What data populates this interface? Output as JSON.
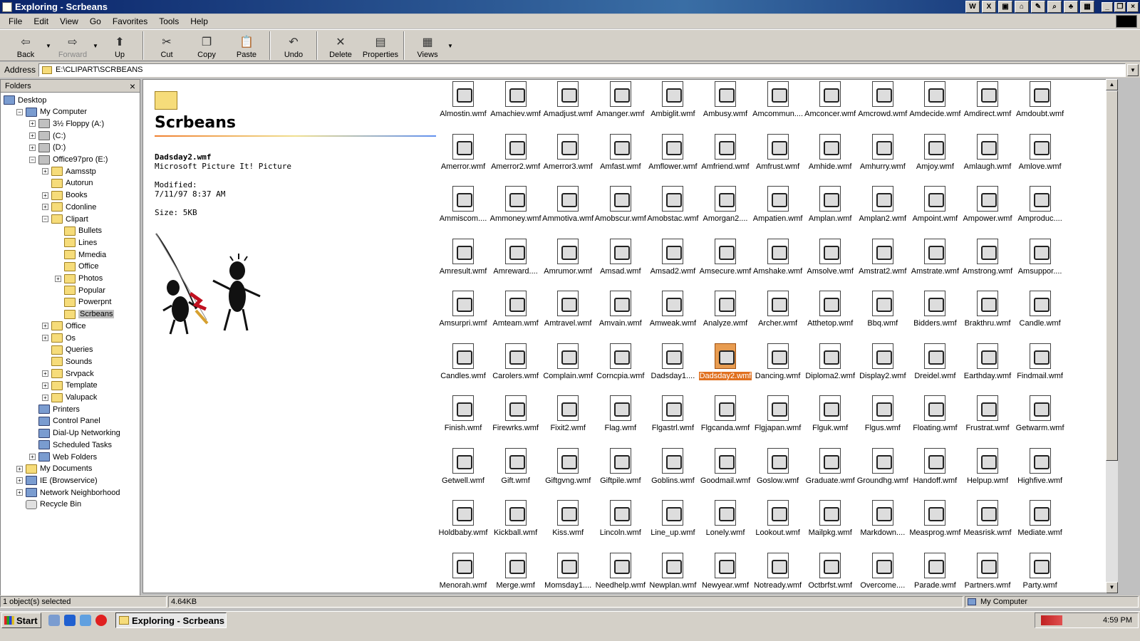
{
  "window": {
    "title": "Exploring - Scrbeans"
  },
  "quick_launch": [
    "W",
    "X",
    "▣",
    "⌂",
    "✎",
    "⌕",
    "♣",
    "▦"
  ],
  "menu": [
    "File",
    "Edit",
    "View",
    "Go",
    "Favorites",
    "Tools",
    "Help"
  ],
  "toolbar": [
    {
      "label": "Back",
      "icon": "⇦"
    },
    {
      "label": "Forward",
      "icon": "⇨",
      "disabled": true
    },
    {
      "label": "Up",
      "icon": "⬆"
    },
    {
      "label": "Cut",
      "icon": "✂"
    },
    {
      "label": "Copy",
      "icon": "❐"
    },
    {
      "label": "Paste",
      "icon": "📋"
    },
    {
      "label": "Undo",
      "icon": "↶"
    },
    {
      "label": "Delete",
      "icon": "✕"
    },
    {
      "label": "Properties",
      "icon": "▤"
    },
    {
      "label": "Views",
      "icon": "▦"
    }
  ],
  "address": {
    "label": "Address",
    "value": "E:\\CLIPART\\SCRBEANS"
  },
  "folders_pane": {
    "title": "Folders",
    "close": "×"
  },
  "tree": [
    {
      "label": "Desktop",
      "level": 0,
      "pm": "",
      "icon": "sys"
    },
    {
      "label": "My Computer",
      "level": 1,
      "pm": "-",
      "icon": "sys"
    },
    {
      "label": "3½ Floppy (A:)",
      "level": 2,
      "pm": "+",
      "icon": "drive"
    },
    {
      "label": "(C:)",
      "level": 2,
      "pm": "+",
      "icon": "drive"
    },
    {
      "label": "(D:)",
      "level": 2,
      "pm": "+",
      "icon": "drive"
    },
    {
      "label": "Office97pro (E:)",
      "level": 2,
      "pm": "-",
      "icon": "drive"
    },
    {
      "label": "Aamsstp",
      "level": 3,
      "pm": "+",
      "icon": "folder"
    },
    {
      "label": "Autorun",
      "level": 3,
      "pm": "",
      "icon": "folder"
    },
    {
      "label": "Books",
      "level": 3,
      "pm": "+",
      "icon": "folder"
    },
    {
      "label": "Cdonline",
      "level": 3,
      "pm": "+",
      "icon": "folder"
    },
    {
      "label": "Clipart",
      "level": 3,
      "pm": "-",
      "icon": "folder"
    },
    {
      "label": "Bullets",
      "level": 4,
      "pm": "",
      "icon": "folder"
    },
    {
      "label": "Lines",
      "level": 4,
      "pm": "",
      "icon": "folder"
    },
    {
      "label": "Mmedia",
      "level": 4,
      "pm": "",
      "icon": "folder"
    },
    {
      "label": "Office",
      "level": 4,
      "pm": "",
      "icon": "folder"
    },
    {
      "label": "Photos",
      "level": 4,
      "pm": "+",
      "icon": "folder"
    },
    {
      "label": "Popular",
      "level": 4,
      "pm": "",
      "icon": "folder"
    },
    {
      "label": "Powerpnt",
      "level": 4,
      "pm": "",
      "icon": "folder"
    },
    {
      "label": "Scrbeans",
      "level": 4,
      "pm": "",
      "icon": "folder",
      "selected": true
    },
    {
      "label": "Office",
      "level": 3,
      "pm": "+",
      "icon": "folder"
    },
    {
      "label": "Os",
      "level": 3,
      "pm": "+",
      "icon": "folder"
    },
    {
      "label": "Queries",
      "level": 3,
      "pm": "",
      "icon": "folder"
    },
    {
      "label": "Sounds",
      "level": 3,
      "pm": "",
      "icon": "folder"
    },
    {
      "label": "Srvpack",
      "level": 3,
      "pm": "+",
      "icon": "folder"
    },
    {
      "label": "Template",
      "level": 3,
      "pm": "+",
      "icon": "folder"
    },
    {
      "label": "Valupack",
      "level": 3,
      "pm": "+",
      "icon": "folder"
    },
    {
      "label": "Printers",
      "level": 2,
      "pm": "",
      "icon": "sys"
    },
    {
      "label": "Control Panel",
      "level": 2,
      "pm": "",
      "icon": "sys"
    },
    {
      "label": "Dial-Up Networking",
      "level": 2,
      "pm": "",
      "icon": "sys"
    },
    {
      "label": "Scheduled Tasks",
      "level": 2,
      "pm": "",
      "icon": "sys"
    },
    {
      "label": "Web Folders",
      "level": 2,
      "pm": "+",
      "icon": "sys"
    },
    {
      "label": "My Documents",
      "level": 1,
      "pm": "+",
      "icon": "folder"
    },
    {
      "label": "IE (Browservice)",
      "level": 1,
      "pm": "+",
      "icon": "sys"
    },
    {
      "label": "Network Neighborhood",
      "level": 1,
      "pm": "+",
      "icon": "sys"
    },
    {
      "label": "Recycle Bin",
      "level": 1,
      "pm": "",
      "icon": "bin"
    }
  ],
  "webview": {
    "folder_name": "Scrbeans",
    "file_name": "Dadsday2.wmf",
    "file_type": "Microsoft Picture It! Picture",
    "modified_label": "Modified:",
    "modified": "7/11/97 8:37 AM",
    "size": "Size: 5KB"
  },
  "files": [
    "Almostin.wmf",
    "Amachiev.wmf",
    "Amadjust.wmf",
    "Amanger.wmf",
    "Ambiglit.wmf",
    "Ambusy.wmf",
    "Amcommun....",
    "Amconcer.wmf",
    "Amcrowd.wmf",
    "Amdecide.wmf",
    "Amdirect.wmf",
    "Amdoubt.wmf",
    "Amerror.wmf",
    "Amerror2.wmf",
    "Amerror3.wmf",
    "Amfast.wmf",
    "Amflower.wmf",
    "Amfriend.wmf",
    "Amfrust.wmf",
    "Amhide.wmf",
    "Amhurry.wmf",
    "Amjoy.wmf",
    "Amlaugh.wmf",
    "Amlove.wmf",
    "Ammiscom....",
    "Ammoney.wmf",
    "Ammotiva.wmf",
    "Amobscur.wmf",
    "Amobstac.wmf",
    "Amorgan2....",
    "Ampatien.wmf",
    "Amplan.wmf",
    "Amplan2.wmf",
    "Ampoint.wmf",
    "Ampower.wmf",
    "Amproduc....",
    "Amresult.wmf",
    "Amreward....",
    "Amrumor.wmf",
    "Amsad.wmf",
    "Amsad2.wmf",
    "Amsecure.wmf",
    "Amshake.wmf",
    "Amsolve.wmf",
    "Amstrat2.wmf",
    "Amstrate.wmf",
    "Amstrong.wmf",
    "Amsuppor....",
    "Amsurpri.wmf",
    "Amteam.wmf",
    "Amtravel.wmf",
    "Amvain.wmf",
    "Amweak.wmf",
    "Analyze.wmf",
    "Archer.wmf",
    "Atthetop.wmf",
    "Bbq.wmf",
    "Bidders.wmf",
    "Brakthru.wmf",
    "Candle.wmf",
    "Candles.wmf",
    "Carolers.wmf",
    "Complain.wmf",
    "Corncpia.wmf",
    "Dadsday1....",
    "Dadsday2.wmf",
    "Dancing.wmf",
    "Diploma2.wmf",
    "Display2.wmf",
    "Dreidel.wmf",
    "Earthday.wmf",
    "Findmail.wmf",
    "Finish.wmf",
    "Firewrks.wmf",
    "Fixit2.wmf",
    "Flag.wmf",
    "Flgastrl.wmf",
    "Flgcanda.wmf",
    "Flgjapan.wmf",
    "Flguk.wmf",
    "Flgus.wmf",
    "Floating.wmf",
    "Frustrat.wmf",
    "Getwarm.wmf",
    "Getwell.wmf",
    "Gift.wmf",
    "Giftgvng.wmf",
    "Giftpile.wmf",
    "Goblins.wmf",
    "Goodmail.wmf",
    "Goslow.wmf",
    "Graduate.wmf",
    "Groundhg.wmf",
    "Handoff.wmf",
    "Helpup.wmf",
    "Highfive.wmf",
    "Holdbaby.wmf",
    "Kickball.wmf",
    "Kiss.wmf",
    "Lincoln.wmf",
    "Line_up.wmf",
    "Lonely.wmf",
    "Lookout.wmf",
    "Mailpkg.wmf",
    "Markdown....",
    "Measprog.wmf",
    "Measrisk.wmf",
    "Mediate.wmf",
    "Menorah.wmf",
    "Merge.wmf",
    "Momsday1....",
    "Needhelp.wmf",
    "Newplan.wmf",
    "Newyear.wmf",
    "Notready.wmf",
    "Octbrfst.wmf",
    "Overcome....",
    "Parade.wmf",
    "Partners.wmf",
    "Party.wmf"
  ],
  "selected_file": "Dadsday2.wmf",
  "status": {
    "selected": "1 object(s) selected",
    "size": "4.64KB",
    "zone": "My Computer"
  },
  "taskbar": {
    "start": "Start",
    "task": "Exploring - Scrbeans",
    "clock": "4:59 PM"
  }
}
